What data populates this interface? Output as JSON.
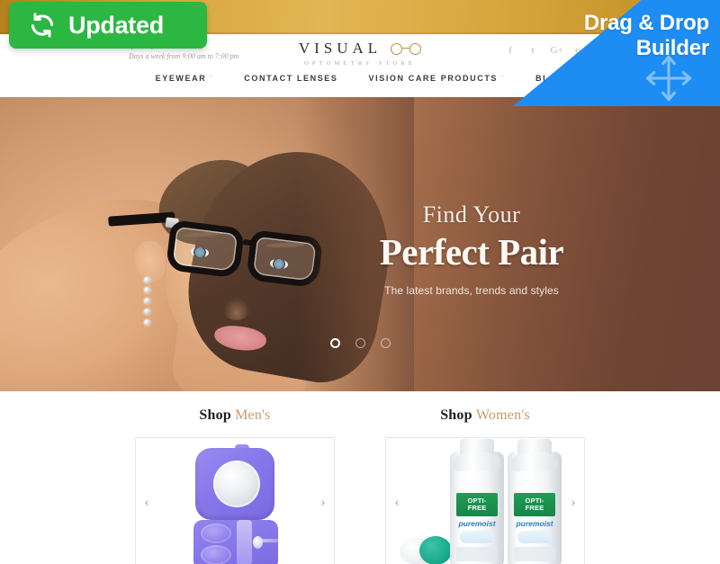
{
  "badges": {
    "updated_label": "Updated",
    "updated_color": "#2cb742",
    "refresh_icon": "refresh-icon",
    "drag_line1": "Drag & Drop",
    "drag_line2": "Builder",
    "drag_color": "#1d8df3",
    "move_icon": "four-way-arrow-icon"
  },
  "header": {
    "phone": "(123) 456-7890",
    "hours": "Days a week from 9:00 am to 7:00 pm",
    "logo_word": "VISUAL",
    "logo_icon": "eyeglasses-icon",
    "logo_sub": "OPTOMETRY STORE",
    "socials": [
      {
        "name": "facebook-icon",
        "glyph": "f"
      },
      {
        "name": "twitter-icon",
        "glyph": "t"
      },
      {
        "name": "google-plus-icon",
        "glyph": "G+"
      },
      {
        "name": "pinterest-icon",
        "glyph": "p"
      }
    ],
    "nav": [
      {
        "label": "EYEWEAR",
        "caret": "ˇ"
      },
      {
        "label": "CONTACT LENSES",
        "caret": ""
      },
      {
        "label": "VISION CARE PRODUCTS",
        "caret": "ˇ"
      },
      {
        "label": "BLOG",
        "caret": ""
      }
    ]
  },
  "hero": {
    "pre_title": "Find Your",
    "title": "Perfect Pair",
    "subtitle": "The latest brands, trends and styles",
    "dots": 3,
    "active_dot": 1,
    "bg_left": "#d8a478",
    "bg_right": "#6b4234"
  },
  "products": {
    "accent_color": "#c99a63",
    "columns": [
      {
        "title_main": "Shop",
        "title_accent": "Men's",
        "image_name": "contact-lens-case-product-image",
        "prev_label": "‹",
        "next_label": "›"
      },
      {
        "title_main": "Shop",
        "title_accent": "Women's",
        "image_name": "opti-free-puremoist-solution-product-image",
        "prev_label": "‹",
        "next_label": "›"
      }
    ],
    "bottle_label": {
      "line1": "OPTI-",
      "line2": "FREE",
      "brand": "puremoist"
    }
  }
}
